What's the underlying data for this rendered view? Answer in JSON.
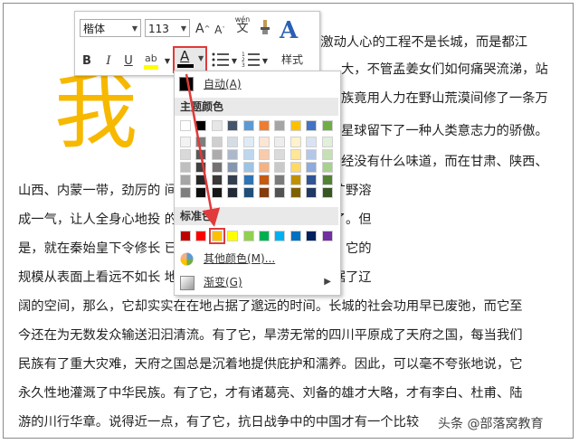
{
  "document": {
    "lines": [
      "",
      "最激动人心的工程不是长城，而是都江",
      "大，不管孟姜女们如何痛哭流涕，站",
      "族竟用人力在野山荒漠间修了一条万",
      "星球留下了一种人类意志力的骄傲。",
      "经没有什么味道，而在甘肃、陕西、",
      "山西、内蒙一带，劲厉的                                间呼啸，淡淡的夕照、荒凉的旷野溶",
      "成一气，让人全身心地投                                 的巨大惊悸，感觉就深厚得多了。但",
      "是，就在秦始皇下令修长                                 已经完成了一个了不起的工程。它的",
      "规模从表面上看远不如长                                 地造福千年。如果说，长城占据了辽",
      "阔的空间，那么，它却实实在在地占据了邈远的时间。长城的社会功用早已废弛，而它至",
      "今还在为无数发众输送汩汩清流。有了它，旱涝无常的四川平原成了天府之国，每当我们",
      "民族有了重大灾难，天府之国总是沉着地提供庇护和濡养。因此，可以毫不夸张地说，它",
      "永久性地灌溉了中华民族。有了它，才有诸葛亮、刘备的雄才大略，才有李白、杜甫、陆",
      "游的川行华章。说得近一点，有了它，抗日战争中的中国才有一个比较"
    ],
    "big_char": "我",
    "watermark": "头条 @部落窝教育"
  },
  "toolbar": {
    "font_name": "楷体",
    "font_size": "113",
    "grow_font": "A",
    "shrink_font": "A",
    "phonetic": "wén",
    "bold": "B",
    "italic": "I",
    "underline": "U",
    "font_color_glyph": "A",
    "styles_label": "样式",
    "styles_glyph": "A"
  },
  "color_menu": {
    "auto_label": "自动(A)",
    "theme_header": "主题颜色",
    "standard_header": "标准色",
    "more_colors_label": "其他颜色(M)...",
    "gradient_label": "渐变(G)",
    "theme_colors": [
      [
        "#ffffff",
        "#f2f2f2",
        "#d9d9d9",
        "#bfbfbf",
        "#a6a6a6",
        "#7f7f7f"
      ],
      [
        "#000000",
        "#7f7f7f",
        "#595959",
        "#404040",
        "#262626",
        "#0d0d0d"
      ],
      [
        "#e7e6e6",
        "#d0cece",
        "#aeabab",
        "#757171",
        "#3a3838",
        "#171616"
      ],
      [
        "#44546a",
        "#d6dce4",
        "#adb9ca",
        "#8496b0",
        "#333f4f",
        "#222a35"
      ],
      [
        "#5b9bd5",
        "#deebf6",
        "#bdd7ee",
        "#9dc3e6",
        "#2e75b6",
        "#1f4e79"
      ],
      [
        "#ed7d31",
        "#fbe5d5",
        "#f7cbac",
        "#f4b183",
        "#c55a11",
        "#843c0c"
      ],
      [
        "#a5a5a5",
        "#ededed",
        "#dbdbdb",
        "#c9c9c9",
        "#7b7b7b",
        "#525252"
      ],
      [
        "#ffc000",
        "#fff2cc",
        "#ffe699",
        "#ffd966",
        "#bf9000",
        "#7f6000"
      ],
      [
        "#4472c4",
        "#dae3f3",
        "#b4c7e7",
        "#8faadc",
        "#2f5597",
        "#203864"
      ],
      [
        "#70ad47",
        "#e2efda",
        "#c5e0b4",
        "#a9d18e",
        "#548235",
        "#375623"
      ]
    ],
    "standard_colors": [
      "#c00000",
      "#ff0000",
      "#ffc000",
      "#ffff00",
      "#92d050",
      "#00b050",
      "#00b0f0",
      "#0070c0",
      "#002060",
      "#7030a0"
    ],
    "selected_standard": 2,
    "highlight_color": "#e03a3a"
  }
}
